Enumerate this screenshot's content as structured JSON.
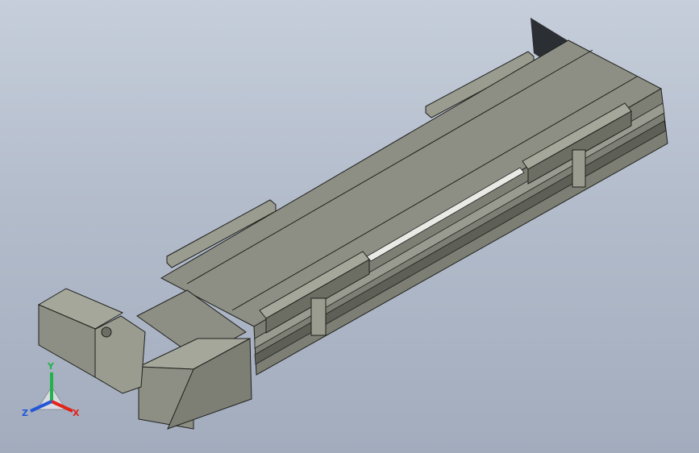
{
  "viewport": {
    "background_top": "#c6cedb",
    "background_bottom": "#a2acbd"
  },
  "model": {
    "body_color": "#8e8f84",
    "body_light": "#a6a79b",
    "body_dark": "#6c6d63",
    "edge_color": "#1f201c",
    "rail_highlight": "#e9e9e6"
  },
  "triad": {
    "x_label": "X",
    "y_label": "Y",
    "z_label": "Z",
    "x_color": "#e2231a",
    "y_color": "#21b34a",
    "z_color": "#2457d6"
  }
}
